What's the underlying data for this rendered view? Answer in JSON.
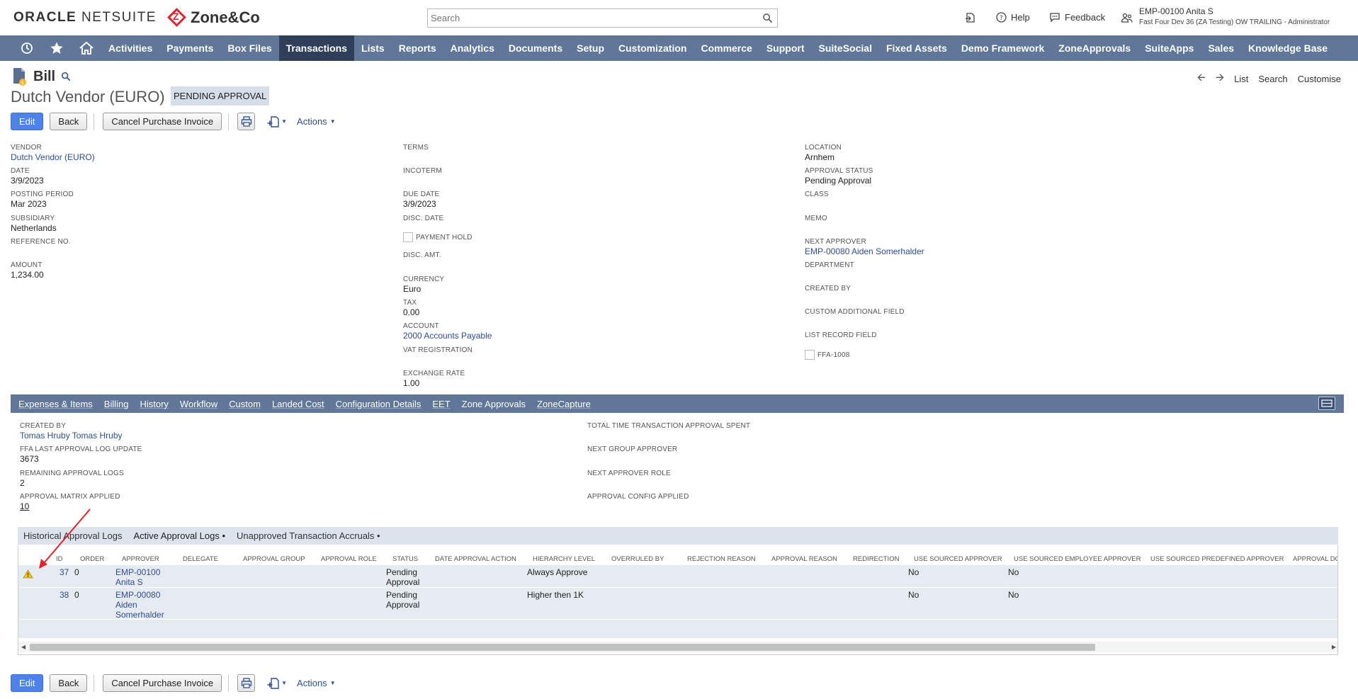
{
  "header": {
    "oracle_logo": "ORACLE",
    "netsuite_logo": "NETSUITE",
    "zone_logo": "Zone&Co",
    "search_placeholder": "Search",
    "help_label": "Help",
    "feedback_label": "Feedback",
    "user_name": "EMP-00100 Anita S",
    "user_role": "Fast Four Dev 36 (ZA Testing) OW TRAILING - Administrator"
  },
  "nav": {
    "items": [
      "Activities",
      "Payments",
      "Box Files",
      "Transactions",
      "Lists",
      "Reports",
      "Analytics",
      "Documents",
      "Setup",
      "Customization",
      "Commerce",
      "Support",
      "SuiteSocial",
      "Fixed Assets",
      "Demo Framework",
      "ZoneApprovals",
      "SuiteApps",
      "Sales",
      "Knowledge Base"
    ],
    "active": "Transactions"
  },
  "page": {
    "record_type": "Bill",
    "title": "Dutch Vendor (EURO)",
    "status": "PENDING APPROVAL",
    "right_links": {
      "list": "List",
      "search": "Search",
      "customise": "Customise"
    }
  },
  "buttons": {
    "edit": "Edit",
    "back": "Back",
    "cancel_invoice": "Cancel Purchase Invoice",
    "actions": "Actions"
  },
  "fields": {
    "col1": {
      "vendor_label": "VENDOR",
      "vendor": "Dutch Vendor (EURO)",
      "date_label": "DATE",
      "date": "3/9/2023",
      "posting_period_label": "POSTING PERIOD",
      "posting_period": "Mar 2023",
      "subsidiary_label": "SUBSIDIARY",
      "subsidiary": "Netherlands",
      "reference_label": "REFERENCE NO.",
      "amount_label": "AMOUNT",
      "amount": "1,234.00"
    },
    "col2": {
      "terms_label": "TERMS",
      "incoterm_label": "INCOTERM",
      "due_date_label": "DUE DATE",
      "due_date": "3/9/2023",
      "disc_date_label": "DISC. DATE",
      "payment_hold_label": "PAYMENT HOLD",
      "disc_amt_label": "DISC. AMT.",
      "currency_label": "CURRENCY",
      "currency": "Euro",
      "tax_label": "TAX",
      "tax": "0.00",
      "account_label": "ACCOUNT",
      "account": "2000 Accounts Payable",
      "vat_label": "VAT REGISTRATION",
      "exchange_rate_label": "EXCHANGE RATE",
      "exchange_rate": "1.00"
    },
    "col3": {
      "location_label": "LOCATION",
      "location": "Arnhem",
      "approval_status_label": "APPROVAL STATUS",
      "approval_status": "Pending Approval",
      "class_label": "CLASS",
      "memo_label": "MEMO",
      "next_approver_label": "NEXT APPROVER",
      "next_approver": "EMP-00080 Aiden Somerhalder",
      "department_label": "DEPARTMENT",
      "created_by_label": "CREATED BY",
      "custom_additional_label": "CUSTOM ADDITIONAL FIELD",
      "list_record_label": "LIST RECORD FIELD",
      "ffa_label": "FFA-1008"
    }
  },
  "subtabs": {
    "items": [
      "Expenses & Items",
      "Billing",
      "History",
      "Workflow",
      "Custom",
      "Landed Cost",
      "Configuration Details",
      "EET",
      "Zone Approvals",
      "ZoneCapture"
    ],
    "active": "Zone Approvals"
  },
  "zone": {
    "created_by_label": "CREATED BY",
    "created_by": "Tomas Hruby Tomas Hruby",
    "ffa_last_label": "FFA LAST APPROVAL LOG UPDATE",
    "ffa_last": "3673",
    "remaining_label": "REMAINING APPROVAL LOGS",
    "remaining": "2",
    "matrix_label": "APPROVAL MATRIX APPLIED",
    "matrix": "10",
    "total_time_label": "TOTAL TIME TRANSACTION APPROVAL SPENT",
    "next_group_label": "NEXT GROUP APPROVER",
    "next_role_label": "NEXT APPROVER ROLE",
    "config_label": "APPROVAL CONFIG APPLIED"
  },
  "sublist_tabs": {
    "items": [
      "Historical Approval Logs",
      "Active Approval Logs •",
      "Unapproved Transaction Accruals •"
    ],
    "active": "Active Approval Logs •"
  },
  "table": {
    "columns": [
      "ID",
      "ORDER",
      "APPROVER",
      "DELEGATE",
      "APPROVAL GROUP",
      "APPROVAL ROLE",
      "STATUS",
      "DATE APPROVAL ACTION",
      "HIERARCHY LEVEL",
      "OVERRULED BY",
      "REJECTION REASON",
      "APPROVAL REASON",
      "REDIRECTION",
      "USE SOURCED APPROVER",
      "USE SOURCED EMPLOYEE APPROVER",
      "USE SOURCED PREDEFINED APPROVER",
      "APPROVAL DO"
    ],
    "rows": [
      {
        "id": "37",
        "order": "0",
        "approver_1": "EMP-00100",
        "approver_2": "Anita S",
        "approver_3": "",
        "status_1": "Pending",
        "status_2": "Approval",
        "hierarchy": "Always Approve",
        "use_sourced": "No",
        "use_sourced_emp": "No",
        "warning": true
      },
      {
        "id": "38",
        "order": "0",
        "approver_1": "EMP-00080",
        "approver_2": "Aiden",
        "approver_3": "Somerhalder",
        "status_1": "Pending",
        "status_2": "Approval",
        "hierarchy": "Higher then 1K",
        "use_sourced": "No",
        "use_sourced_emp": "No",
        "warning": false
      }
    ]
  },
  "colors": {
    "nav_bg": "#607799",
    "nav_active": "#2f3f5a",
    "link": "#2f4e8e",
    "primary_button": "#4d83e8",
    "annotation_arrow": "#e0242b"
  }
}
